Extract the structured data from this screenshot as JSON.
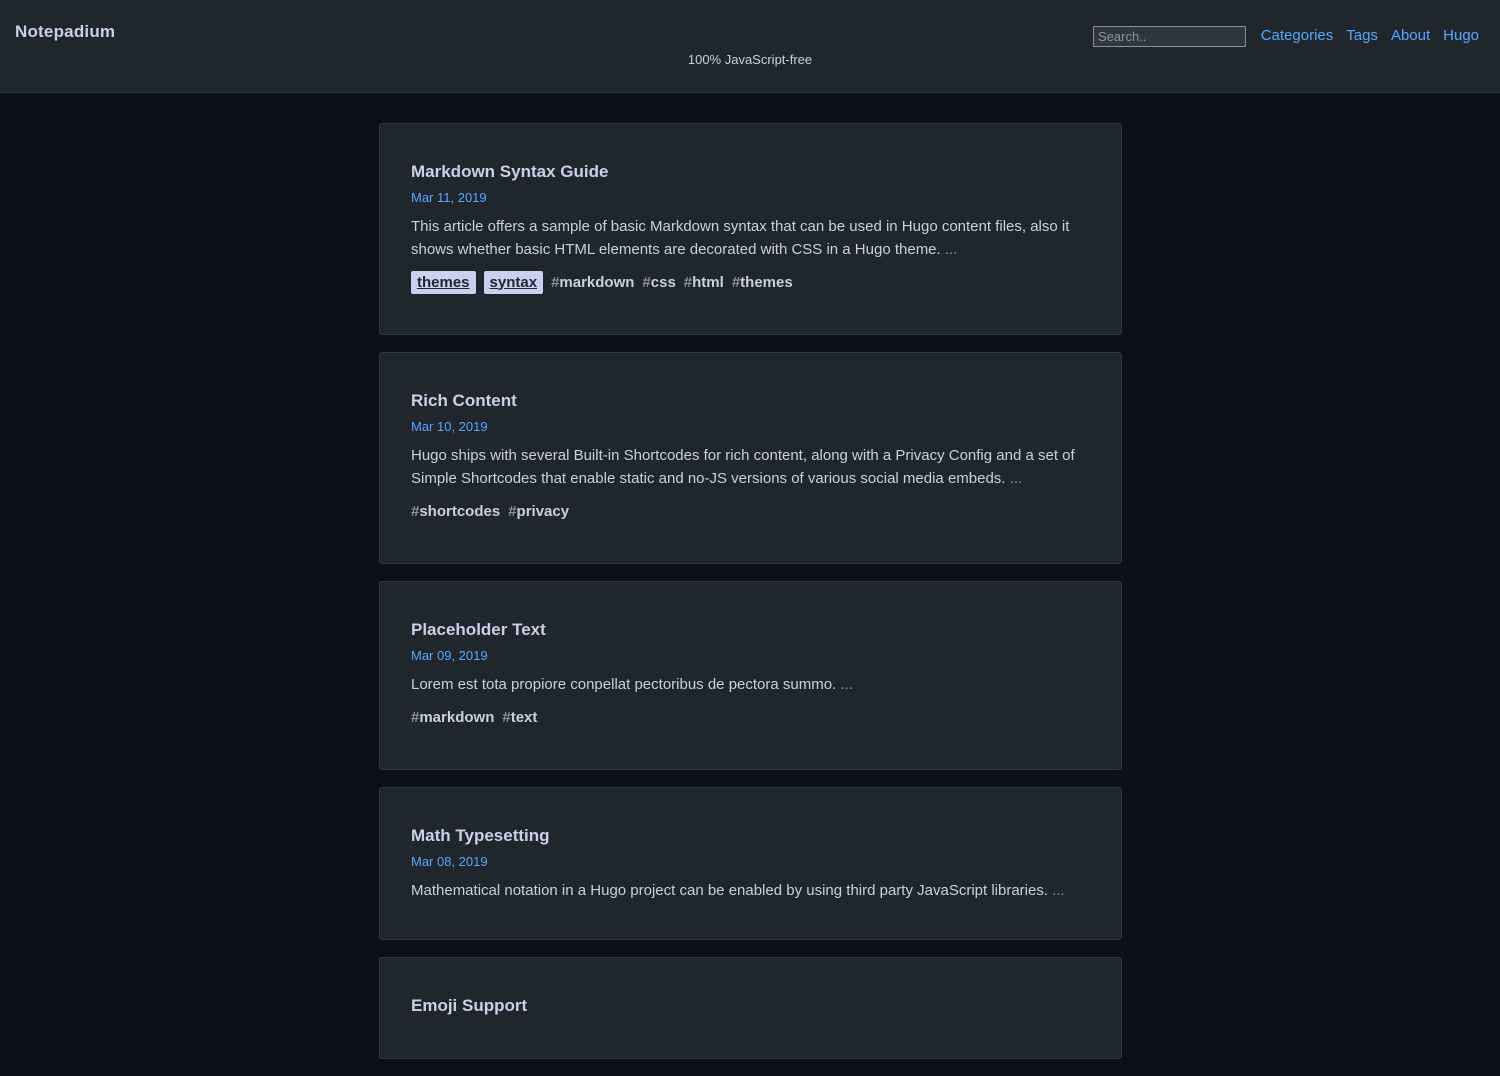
{
  "site": {
    "brand": "Notepadium",
    "tagline": "100% JavaScript-free"
  },
  "search": {
    "placeholder": "Search.."
  },
  "nav": {
    "items": [
      "Categories",
      "Tags",
      "About",
      "Hugo"
    ]
  },
  "posts": [
    {
      "title": "Markdown Syntax Guide",
      "date": "Mar 11, 2019",
      "summary": "This article offers a sample of basic Markdown syntax that can be used in Hugo content files, also it shows whether basic HTML elements are decorated with CSS in a Hugo theme.",
      "more": "...",
      "categories": [
        "themes",
        "syntax"
      ],
      "tags": [
        "markdown",
        "css",
        "html",
        "themes"
      ]
    },
    {
      "title": "Rich Content",
      "date": "Mar 10, 2019",
      "summary": "Hugo ships with several Built-in Shortcodes for rich content, along with a Privacy Config and a set of Simple Shortcodes that enable static and no-JS versions of various social media embeds.",
      "more": "...",
      "categories": [],
      "tags": [
        "shortcodes",
        "privacy"
      ]
    },
    {
      "title": "Placeholder Text",
      "date": "Mar 09, 2019",
      "summary": "Lorem est tota propiore conpellat pectoribus de pectora summo.",
      "more": "...",
      "categories": [],
      "tags": [
        "markdown",
        "text"
      ]
    },
    {
      "title": "Math Typesetting",
      "date": "Mar 08, 2019",
      "summary": "Mathematical notation in a Hugo project can be enabled by using third party JavaScript libraries.",
      "more": "...",
      "categories": [],
      "tags": []
    },
    {
      "title": "Emoji Support",
      "date": "",
      "summary": "",
      "more": "",
      "categories": [],
      "tags": []
    }
  ],
  "tag_prefix": "#",
  "colors": {
    "background": "#0d1117",
    "surface": "#21262d",
    "accent": "#58a6ff",
    "chip": "#c9d1f0"
  }
}
